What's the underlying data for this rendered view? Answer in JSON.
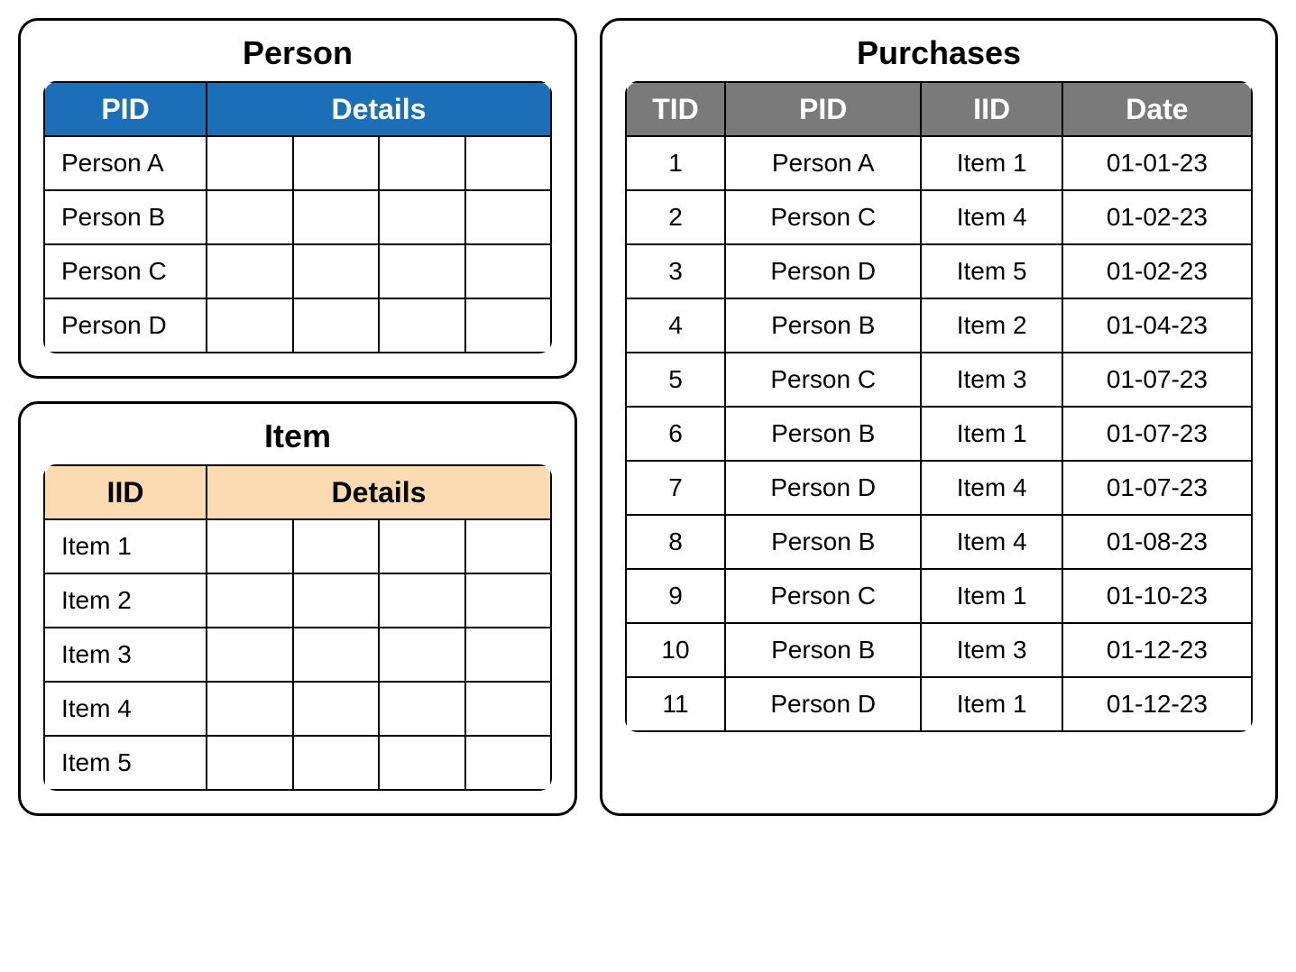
{
  "person": {
    "title": "Person",
    "headers": {
      "pid": "PID",
      "details": "Details"
    },
    "rows": [
      {
        "pid": "Person A"
      },
      {
        "pid": "Person B"
      },
      {
        "pid": "Person C"
      },
      {
        "pid": "Person D"
      }
    ]
  },
  "item": {
    "title": "Item",
    "headers": {
      "iid": "IID",
      "details": "Details"
    },
    "rows": [
      {
        "iid": "Item 1"
      },
      {
        "iid": "Item 2"
      },
      {
        "iid": "Item 3"
      },
      {
        "iid": "Item 4"
      },
      {
        "iid": "Item 5"
      }
    ]
  },
  "purchases": {
    "title": "Purchases",
    "headers": {
      "tid": "TID",
      "pid": "PID",
      "iid": "IID",
      "date": "Date"
    },
    "rows": [
      {
        "tid": "1",
        "pid": "Person A",
        "iid": "Item 1",
        "date": "01-01-23"
      },
      {
        "tid": "2",
        "pid": "Person C",
        "iid": "Item 4",
        "date": "01-02-23"
      },
      {
        "tid": "3",
        "pid": "Person D",
        "iid": "Item 5",
        "date": "01-02-23"
      },
      {
        "tid": "4",
        "pid": "Person B",
        "iid": "Item 2",
        "date": "01-04-23"
      },
      {
        "tid": "5",
        "pid": "Person C",
        "iid": "Item 3",
        "date": "01-07-23"
      },
      {
        "tid": "6",
        "pid": "Person B",
        "iid": "Item 1",
        "date": "01-07-23"
      },
      {
        "tid": "7",
        "pid": "Person D",
        "iid": "Item 4",
        "date": "01-07-23"
      },
      {
        "tid": "8",
        "pid": "Person B",
        "iid": "Item 4",
        "date": "01-08-23"
      },
      {
        "tid": "9",
        "pid": "Person C",
        "iid": "Item 1",
        "date": "01-10-23"
      },
      {
        "tid": "10",
        "pid": "Person B",
        "iid": "Item 3",
        "date": "01-12-23"
      },
      {
        "tid": "11",
        "pid": "Person D",
        "iid": "Item 1",
        "date": "01-12-23"
      }
    ]
  }
}
